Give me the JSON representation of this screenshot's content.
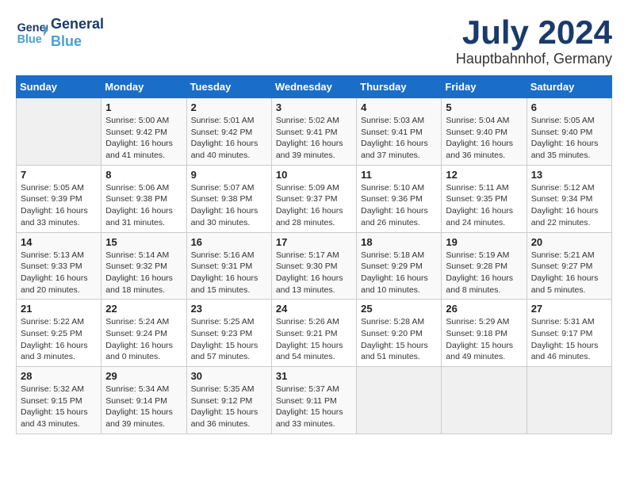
{
  "header": {
    "logo_line1": "General",
    "logo_line2": "Blue",
    "month": "July 2024",
    "location": "Hauptbahnhof, Germany"
  },
  "weekdays": [
    "Sunday",
    "Monday",
    "Tuesday",
    "Wednesday",
    "Thursday",
    "Friday",
    "Saturday"
  ],
  "weeks": [
    [
      {
        "day": "",
        "info": ""
      },
      {
        "day": "1",
        "info": "Sunrise: 5:00 AM\nSunset: 9:42 PM\nDaylight: 16 hours\nand 41 minutes."
      },
      {
        "day": "2",
        "info": "Sunrise: 5:01 AM\nSunset: 9:42 PM\nDaylight: 16 hours\nand 40 minutes."
      },
      {
        "day": "3",
        "info": "Sunrise: 5:02 AM\nSunset: 9:41 PM\nDaylight: 16 hours\nand 39 minutes."
      },
      {
        "day": "4",
        "info": "Sunrise: 5:03 AM\nSunset: 9:41 PM\nDaylight: 16 hours\nand 37 minutes."
      },
      {
        "day": "5",
        "info": "Sunrise: 5:04 AM\nSunset: 9:40 PM\nDaylight: 16 hours\nand 36 minutes."
      },
      {
        "day": "6",
        "info": "Sunrise: 5:05 AM\nSunset: 9:40 PM\nDaylight: 16 hours\nand 35 minutes."
      }
    ],
    [
      {
        "day": "7",
        "info": "Sunrise: 5:05 AM\nSunset: 9:39 PM\nDaylight: 16 hours\nand 33 minutes."
      },
      {
        "day": "8",
        "info": "Sunrise: 5:06 AM\nSunset: 9:38 PM\nDaylight: 16 hours\nand 31 minutes."
      },
      {
        "day": "9",
        "info": "Sunrise: 5:07 AM\nSunset: 9:38 PM\nDaylight: 16 hours\nand 30 minutes."
      },
      {
        "day": "10",
        "info": "Sunrise: 5:09 AM\nSunset: 9:37 PM\nDaylight: 16 hours\nand 28 minutes."
      },
      {
        "day": "11",
        "info": "Sunrise: 5:10 AM\nSunset: 9:36 PM\nDaylight: 16 hours\nand 26 minutes."
      },
      {
        "day": "12",
        "info": "Sunrise: 5:11 AM\nSunset: 9:35 PM\nDaylight: 16 hours\nand 24 minutes."
      },
      {
        "day": "13",
        "info": "Sunrise: 5:12 AM\nSunset: 9:34 PM\nDaylight: 16 hours\nand 22 minutes."
      }
    ],
    [
      {
        "day": "14",
        "info": "Sunrise: 5:13 AM\nSunset: 9:33 PM\nDaylight: 16 hours\nand 20 minutes."
      },
      {
        "day": "15",
        "info": "Sunrise: 5:14 AM\nSunset: 9:32 PM\nDaylight: 16 hours\nand 18 minutes."
      },
      {
        "day": "16",
        "info": "Sunrise: 5:16 AM\nSunset: 9:31 PM\nDaylight: 16 hours\nand 15 minutes."
      },
      {
        "day": "17",
        "info": "Sunrise: 5:17 AM\nSunset: 9:30 PM\nDaylight: 16 hours\nand 13 minutes."
      },
      {
        "day": "18",
        "info": "Sunrise: 5:18 AM\nSunset: 9:29 PM\nDaylight: 16 hours\nand 10 minutes."
      },
      {
        "day": "19",
        "info": "Sunrise: 5:19 AM\nSunset: 9:28 PM\nDaylight: 16 hours\nand 8 minutes."
      },
      {
        "day": "20",
        "info": "Sunrise: 5:21 AM\nSunset: 9:27 PM\nDaylight: 16 hours\nand 5 minutes."
      }
    ],
    [
      {
        "day": "21",
        "info": "Sunrise: 5:22 AM\nSunset: 9:25 PM\nDaylight: 16 hours\nand 3 minutes."
      },
      {
        "day": "22",
        "info": "Sunrise: 5:24 AM\nSunset: 9:24 PM\nDaylight: 16 hours\nand 0 minutes."
      },
      {
        "day": "23",
        "info": "Sunrise: 5:25 AM\nSunset: 9:23 PM\nDaylight: 15 hours\nand 57 minutes."
      },
      {
        "day": "24",
        "info": "Sunrise: 5:26 AM\nSunset: 9:21 PM\nDaylight: 15 hours\nand 54 minutes."
      },
      {
        "day": "25",
        "info": "Sunrise: 5:28 AM\nSunset: 9:20 PM\nDaylight: 15 hours\nand 51 minutes."
      },
      {
        "day": "26",
        "info": "Sunrise: 5:29 AM\nSunset: 9:18 PM\nDaylight: 15 hours\nand 49 minutes."
      },
      {
        "day": "27",
        "info": "Sunrise: 5:31 AM\nSunset: 9:17 PM\nDaylight: 15 hours\nand 46 minutes."
      }
    ],
    [
      {
        "day": "28",
        "info": "Sunrise: 5:32 AM\nSunset: 9:15 PM\nDaylight: 15 hours\nand 43 minutes."
      },
      {
        "day": "29",
        "info": "Sunrise: 5:34 AM\nSunset: 9:14 PM\nDaylight: 15 hours\nand 39 minutes."
      },
      {
        "day": "30",
        "info": "Sunrise: 5:35 AM\nSunset: 9:12 PM\nDaylight: 15 hours\nand 36 minutes."
      },
      {
        "day": "31",
        "info": "Sunrise: 5:37 AM\nSunset: 9:11 PM\nDaylight: 15 hours\nand 33 minutes."
      },
      {
        "day": "",
        "info": ""
      },
      {
        "day": "",
        "info": ""
      },
      {
        "day": "",
        "info": ""
      }
    ]
  ]
}
